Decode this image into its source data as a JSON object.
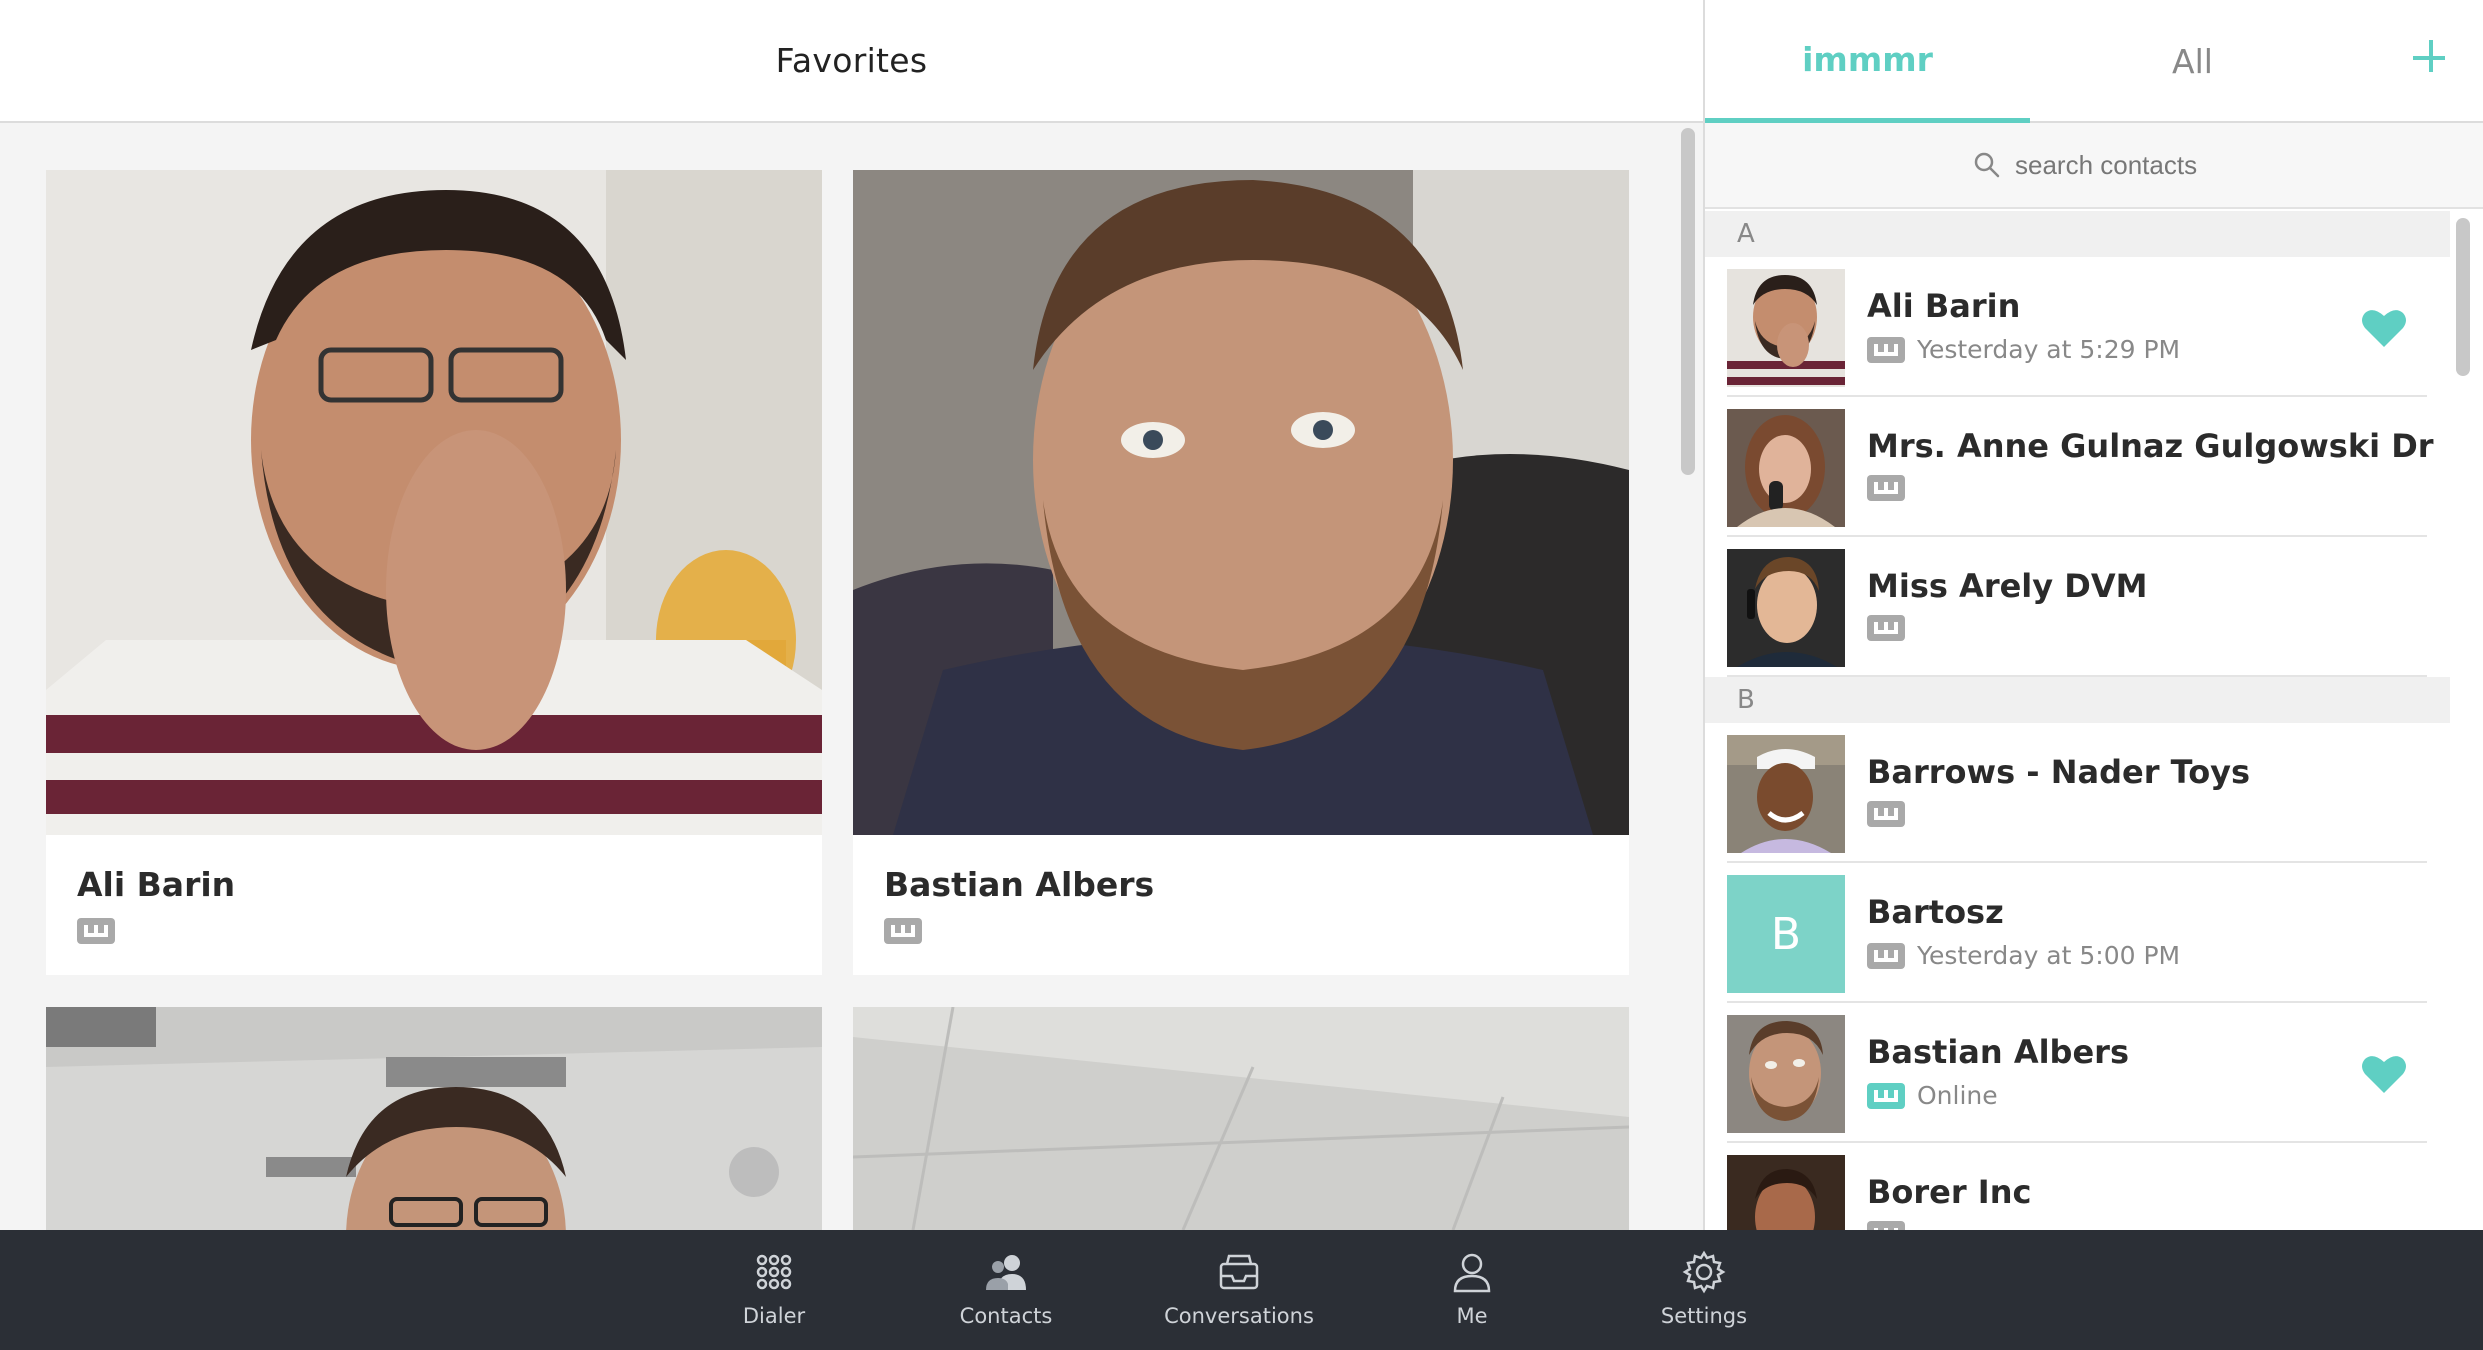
{
  "favorites": {
    "title": "Favorites",
    "cards": [
      {
        "name": "Ali Barin"
      },
      {
        "name": "Bastian Albers"
      },
      {
        "name": ""
      },
      {
        "name": ""
      }
    ]
  },
  "contacts": {
    "tabs": [
      {
        "label": "immmr",
        "active": true
      },
      {
        "label": "All",
        "active": false
      }
    ],
    "search_placeholder": "search contacts",
    "sections": [
      {
        "letter": "A",
        "items": [
          {
            "name": "Ali Barin",
            "status": "Yesterday at 5:29 PM",
            "favorite": true
          },
          {
            "name": "Mrs. Anne Gulnaz Gulgowski Dr",
            "status": "",
            "favorite": false
          },
          {
            "name": "Miss Arely DVM",
            "status": "",
            "favorite": false
          }
        ]
      },
      {
        "letter": "B",
        "items": [
          {
            "name": "Barrows - Nader Toys",
            "status": "",
            "favorite": false
          },
          {
            "name": "Bartosz",
            "status": "Yesterday at 5:00 PM",
            "favorite": false,
            "initial": "B"
          },
          {
            "name": "Bastian Albers",
            "status": "Online",
            "favorite": true
          },
          {
            "name": "Borer Inc",
            "status": "",
            "favorite": false
          }
        ]
      }
    ]
  },
  "nav": {
    "items": [
      {
        "label": "Dialer",
        "icon": "dialpad-icon"
      },
      {
        "label": "Contacts",
        "icon": "contacts-icon"
      },
      {
        "label": "Conversations",
        "icon": "inbox-icon"
      },
      {
        "label": "Me",
        "icon": "person-icon"
      },
      {
        "label": "Settings",
        "icon": "gear-icon"
      }
    ]
  },
  "colors": {
    "accent": "#5fcfc3",
    "nav_bg": "#2b2f36",
    "tag_grey": "#a9a9a9"
  }
}
